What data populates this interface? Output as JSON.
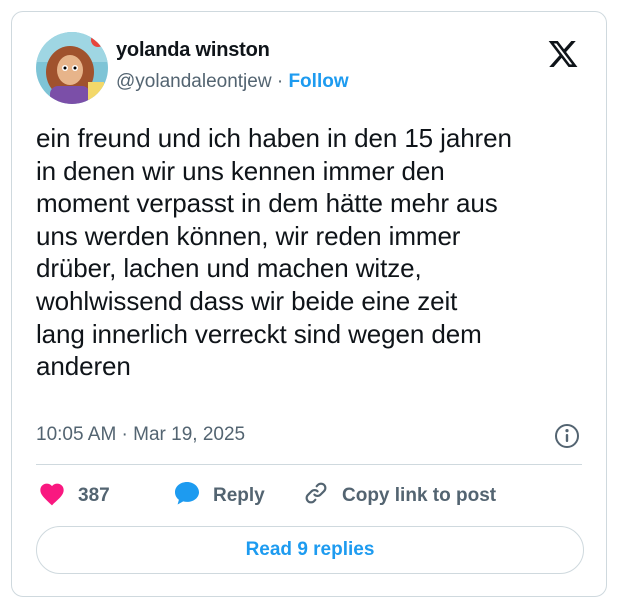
{
  "author": {
    "display_name": "yolanda winston",
    "handle": "@yolandaleontjew",
    "separator": "·",
    "follow_label": "Follow"
  },
  "tweet": {
    "text": "ein freund und ich haben in den 15 jahren\nin denen wir uns kennen immer den\nmoment verpasst in dem hätte mehr aus\nuns werden können, wir reden immer\ndrüber, lachen und machen witze,\nwohlwissend dass wir beide eine zeit\nlang innerlich verreckt sind wegen dem\nanderen",
    "timestamp": "10:05 AM · Mar 19, 2025"
  },
  "actions": {
    "like_count": "387",
    "reply_label": "Reply",
    "copy_link_label": "Copy link to post"
  },
  "footer": {
    "read_replies_label": "Read 9 replies"
  },
  "icons": {
    "brand": "x-logo-icon",
    "info": "info-icon",
    "like": "heart-icon",
    "reply": "speech-bubble-icon",
    "copy_link": "link-icon"
  },
  "colors": {
    "accent": "#1d9bf0",
    "like": "#f91880",
    "muted_text": "#536471",
    "border": "#cfd9de"
  }
}
